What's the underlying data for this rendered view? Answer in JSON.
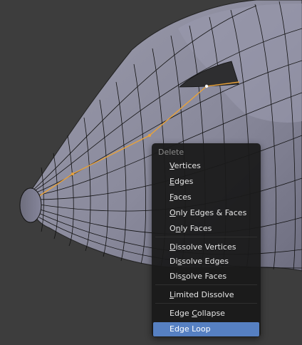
{
  "delete_menu": {
    "title": "Delete",
    "items": [
      {
        "id": "vertices",
        "pre": "",
        "key": "V",
        "post": "ertices",
        "label": "Vertices"
      },
      {
        "id": "edges",
        "pre": "",
        "key": "E",
        "post": "dges",
        "label": "Edges"
      },
      {
        "id": "faces",
        "pre": "",
        "key": "F",
        "post": "aces",
        "label": "Faces"
      },
      {
        "id": "only-edges-faces",
        "pre": "",
        "key": "O",
        "post": "nly Edges & Faces",
        "label": "Only Edges & Faces"
      },
      {
        "id": "only-faces",
        "pre": "O",
        "key": "n",
        "post": "ly Faces",
        "label": "Only Faces"
      },
      {
        "id": "dissolve-vertices",
        "pre": "",
        "key": "D",
        "post": "issolve Vertices",
        "label": "Dissolve Vertices"
      },
      {
        "id": "dissolve-edges",
        "pre": "Di",
        "key": "s",
        "post": "solve Edges",
        "label": "Dissolve Edges"
      },
      {
        "id": "dissolve-faces",
        "pre": "Dis",
        "key": "s",
        "post": "olve Faces",
        "label": "Dissolve Faces"
      },
      {
        "id": "limited-dissolve",
        "pre": "",
        "key": "L",
        "post": "imited Dissolve",
        "label": "Limited Dissolve"
      },
      {
        "id": "edge-collapse",
        "pre": "Edge ",
        "key": "C",
        "post": "ollapse",
        "label": "Edge Collapse"
      },
      {
        "id": "edge-loop",
        "pre": "Edge Loop",
        "key": "",
        "post": "",
        "label": "Edge Loop",
        "active": true
      }
    ]
  },
  "colors": {
    "viewport_background": "#3d3d3d",
    "mesh_face": "#8a8a9c",
    "mesh_wire": "#000000",
    "selected_edge": "#e8a23a",
    "menu_background": "#1a1a1a",
    "menu_highlight": "#5680c2",
    "menu_text": "#e6e6e6",
    "menu_title_text": "#8a8a8a"
  }
}
